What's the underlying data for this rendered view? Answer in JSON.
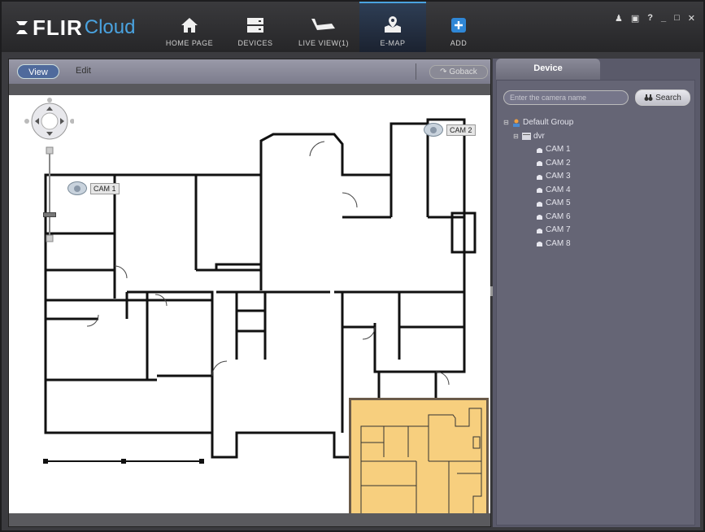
{
  "app": {
    "logo_main": "FLIR",
    "logo_sub": "Cloud"
  },
  "nav": [
    {
      "id": "home",
      "label": "HOME PAGE",
      "icon": "home-icon"
    },
    {
      "id": "devices",
      "label": "DEVICES",
      "icon": "devices-icon"
    },
    {
      "id": "live",
      "label": "LIVE VIEW(1)",
      "icon": "camera-icon"
    },
    {
      "id": "emap",
      "label": "E-MAP",
      "icon": "map-pin-icon",
      "active": true
    },
    {
      "id": "add",
      "label": "ADD",
      "icon": "plus-icon"
    }
  ],
  "window_controls": {
    "user": "user-icon",
    "lock": "lock-icon",
    "help": "?",
    "min": "_",
    "max": "□",
    "close": "✕"
  },
  "map_toolbar": {
    "view_label": "View",
    "edit_label": "Edit",
    "goback_label": "Goback"
  },
  "map": {
    "cameras": [
      {
        "label": "CAM 1"
      },
      {
        "label": "CAM 2"
      }
    ],
    "zoom_level": 0.28
  },
  "panel": {
    "tab_label": "Device",
    "search": {
      "placeholder": "Enter the camera name",
      "button_label": "Search"
    },
    "tree": {
      "root": "Default Group",
      "device": "dvr",
      "cameras": [
        "CAM 1",
        "CAM 2",
        "CAM 3",
        "CAM 4",
        "CAM 5",
        "CAM 6",
        "CAM 7",
        "CAM 8"
      ]
    }
  },
  "colors": {
    "accent": "#4aa3e0",
    "minimap": "#f7cf7e",
    "panel": "#656575"
  }
}
